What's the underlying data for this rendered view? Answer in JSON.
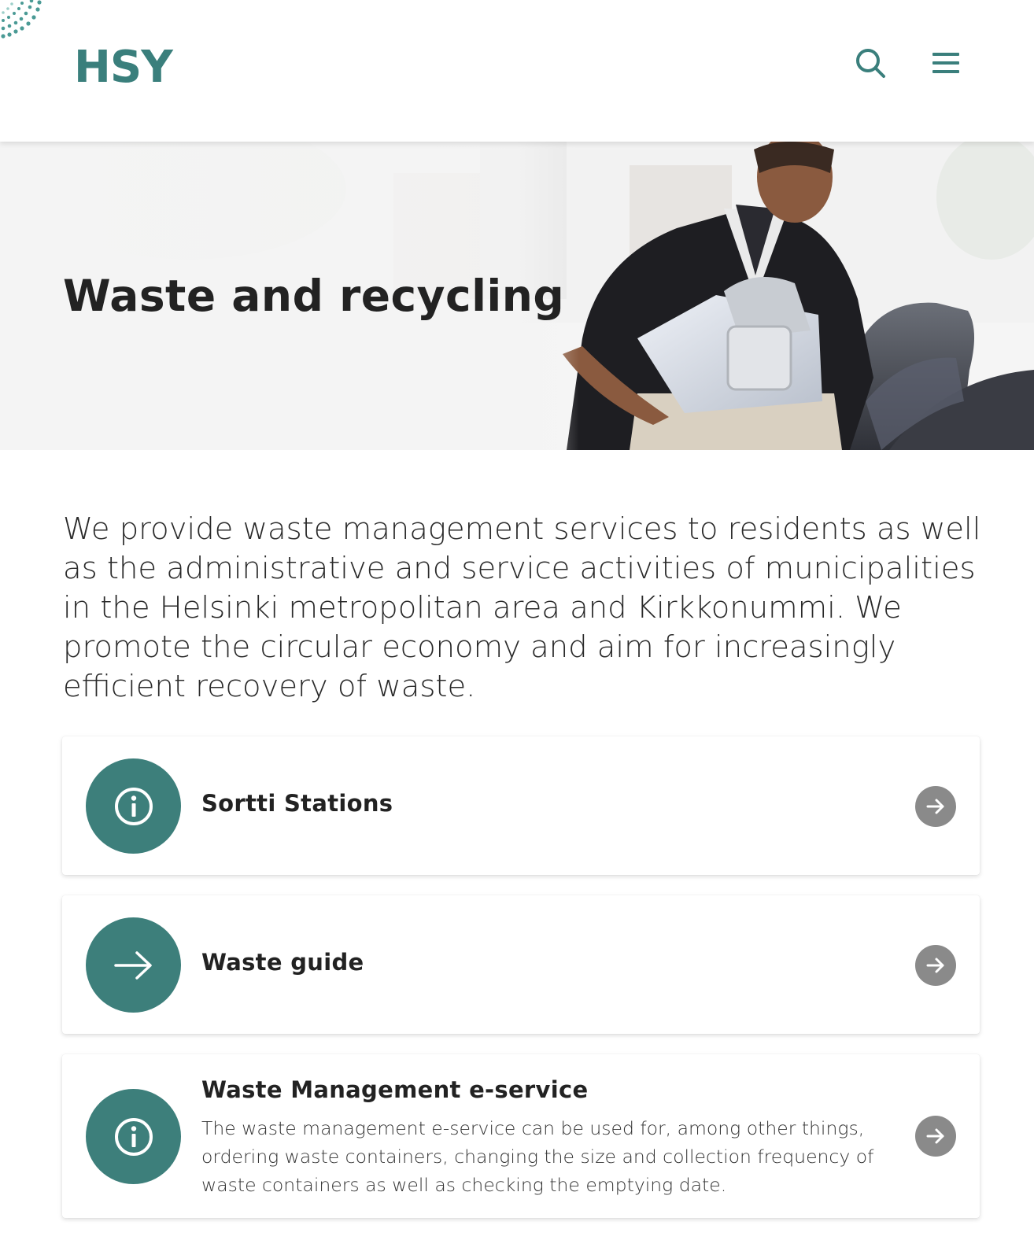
{
  "header": {
    "logo_text": "HSY",
    "brand_color": "#3a7f7c",
    "search_icon": "search-icon",
    "menu_icon": "hamburger-menu-icon"
  },
  "hero": {
    "title": "Waste and recycling"
  },
  "intro": {
    "text": "We provide waste management services to residents as well as the administrative and service activities of municipalities in the Helsinki metropolitan area and Kirkkonummi. We promote the circular economy and aim for increasingly efficient recovery of waste."
  },
  "cards": [
    {
      "icon": "info-icon",
      "title": "Sortti Stations",
      "description": "",
      "arrow_icon": "arrow-right-icon"
    },
    {
      "icon": "arrow-right-icon",
      "title": "Waste guide",
      "description": "",
      "arrow_icon": "arrow-right-icon"
    },
    {
      "icon": "info-icon",
      "title": "Waste Management e-service",
      "description": "The waste management e-service can be used for, among other things, ordering waste containers, changing the size and collection frequency of waste containers as well as checking the emptying date.",
      "arrow_icon": "arrow-right-icon"
    }
  ],
  "colors": {
    "accent": "#3d7f7b",
    "arrow_button": "#8a8a8a"
  }
}
